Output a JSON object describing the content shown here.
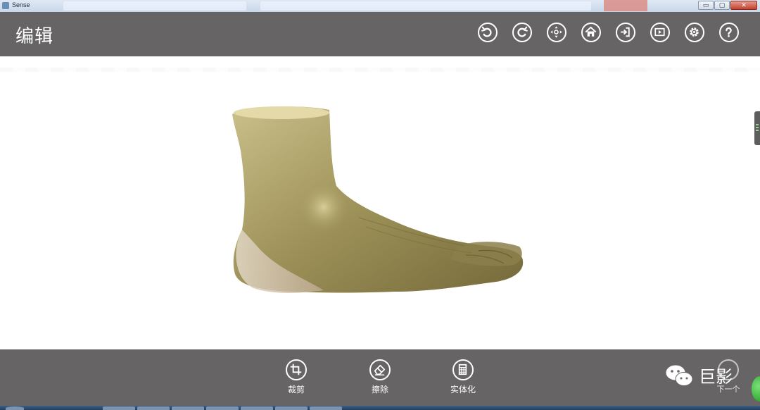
{
  "window": {
    "title": "Sense",
    "controls": {
      "minimize": "▭",
      "maximize": "▢",
      "close": "✕"
    }
  },
  "header": {
    "title": "编辑",
    "tools": [
      {
        "name": "undo-icon"
      },
      {
        "name": "redo-icon"
      },
      {
        "name": "move-icon"
      },
      {
        "name": "home-icon"
      },
      {
        "name": "export-icon"
      },
      {
        "name": "play-icon"
      },
      {
        "name": "settings-icon"
      },
      {
        "name": "help-icon"
      }
    ]
  },
  "bottom": {
    "tools": [
      {
        "icon": "crop-icon",
        "label": "裁剪"
      },
      {
        "icon": "eraser-icon",
        "label": "擦除"
      },
      {
        "icon": "solidify-icon",
        "label": "实体化"
      }
    ],
    "next_label": "下一个",
    "watermark_text": "巨影"
  },
  "colors": {
    "toolbar_bg": "#666464",
    "viewport_bg": "#ffffff",
    "icon_stroke": "#ffffff",
    "model_tone": "#a69a62"
  }
}
